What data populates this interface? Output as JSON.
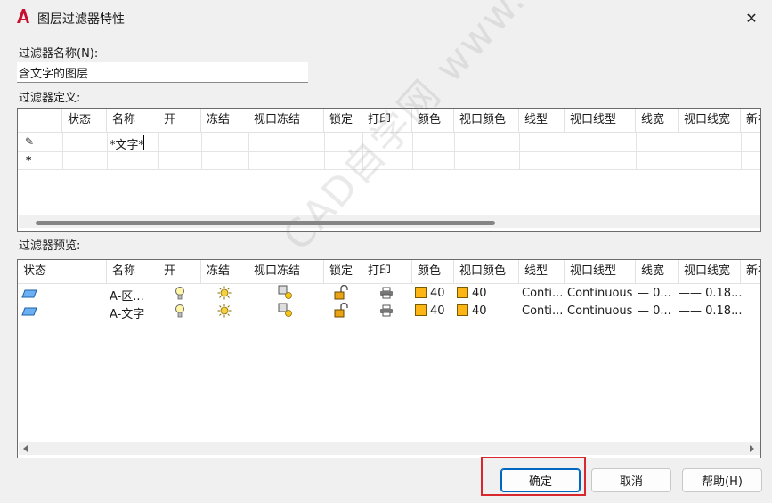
{
  "window": {
    "title": "图层过滤器特性",
    "close_glyph": "✕"
  },
  "name_label": "过滤器名称(N):",
  "filter_name_value": "含文字的图层",
  "definition_label": "过滤器定义:",
  "preview_label": "过滤器预览:",
  "definition_grid": {
    "headers": [
      "状态",
      "名称",
      "开",
      "冻结",
      "视口冻结",
      "锁定",
      "打印",
      "颜色",
      "视口颜色",
      "线型",
      "视口线型",
      "线宽",
      "视口线宽",
      "新视"
    ],
    "rows": [
      {
        "marker": "✎",
        "name": "*文字*"
      },
      {
        "marker": "*",
        "name": ""
      }
    ]
  },
  "preview_grid": {
    "headers": [
      "状态",
      "名称",
      "开",
      "冻结",
      "视口冻结",
      "锁定",
      "打印",
      "颜色",
      "视口颜色",
      "线型",
      "视口线型",
      "线宽",
      "视口线宽",
      "新视"
    ],
    "rows": [
      {
        "name": "A-区...",
        "color": "40",
        "vp_color": "40",
        "linetype": "Conti...",
        "vp_linetype": "Continuous",
        "lineweight": "— 0...",
        "vp_lineweight": "—— 0.18..."
      },
      {
        "name": "A-文字",
        "color": "40",
        "vp_color": "40",
        "linetype": "Conti...",
        "vp_linetype": "Continuous",
        "lineweight": "— 0...",
        "vp_lineweight": "—— 0.18..."
      }
    ]
  },
  "buttons": {
    "ok": "确定",
    "cancel": "取消",
    "help": "帮助(H)"
  },
  "watermark": "CAD自学网 www.cadzxw.com",
  "colors": {
    "accent": "#0067c0",
    "highlight": "#d9272e",
    "layer_color": "#fcb514"
  }
}
